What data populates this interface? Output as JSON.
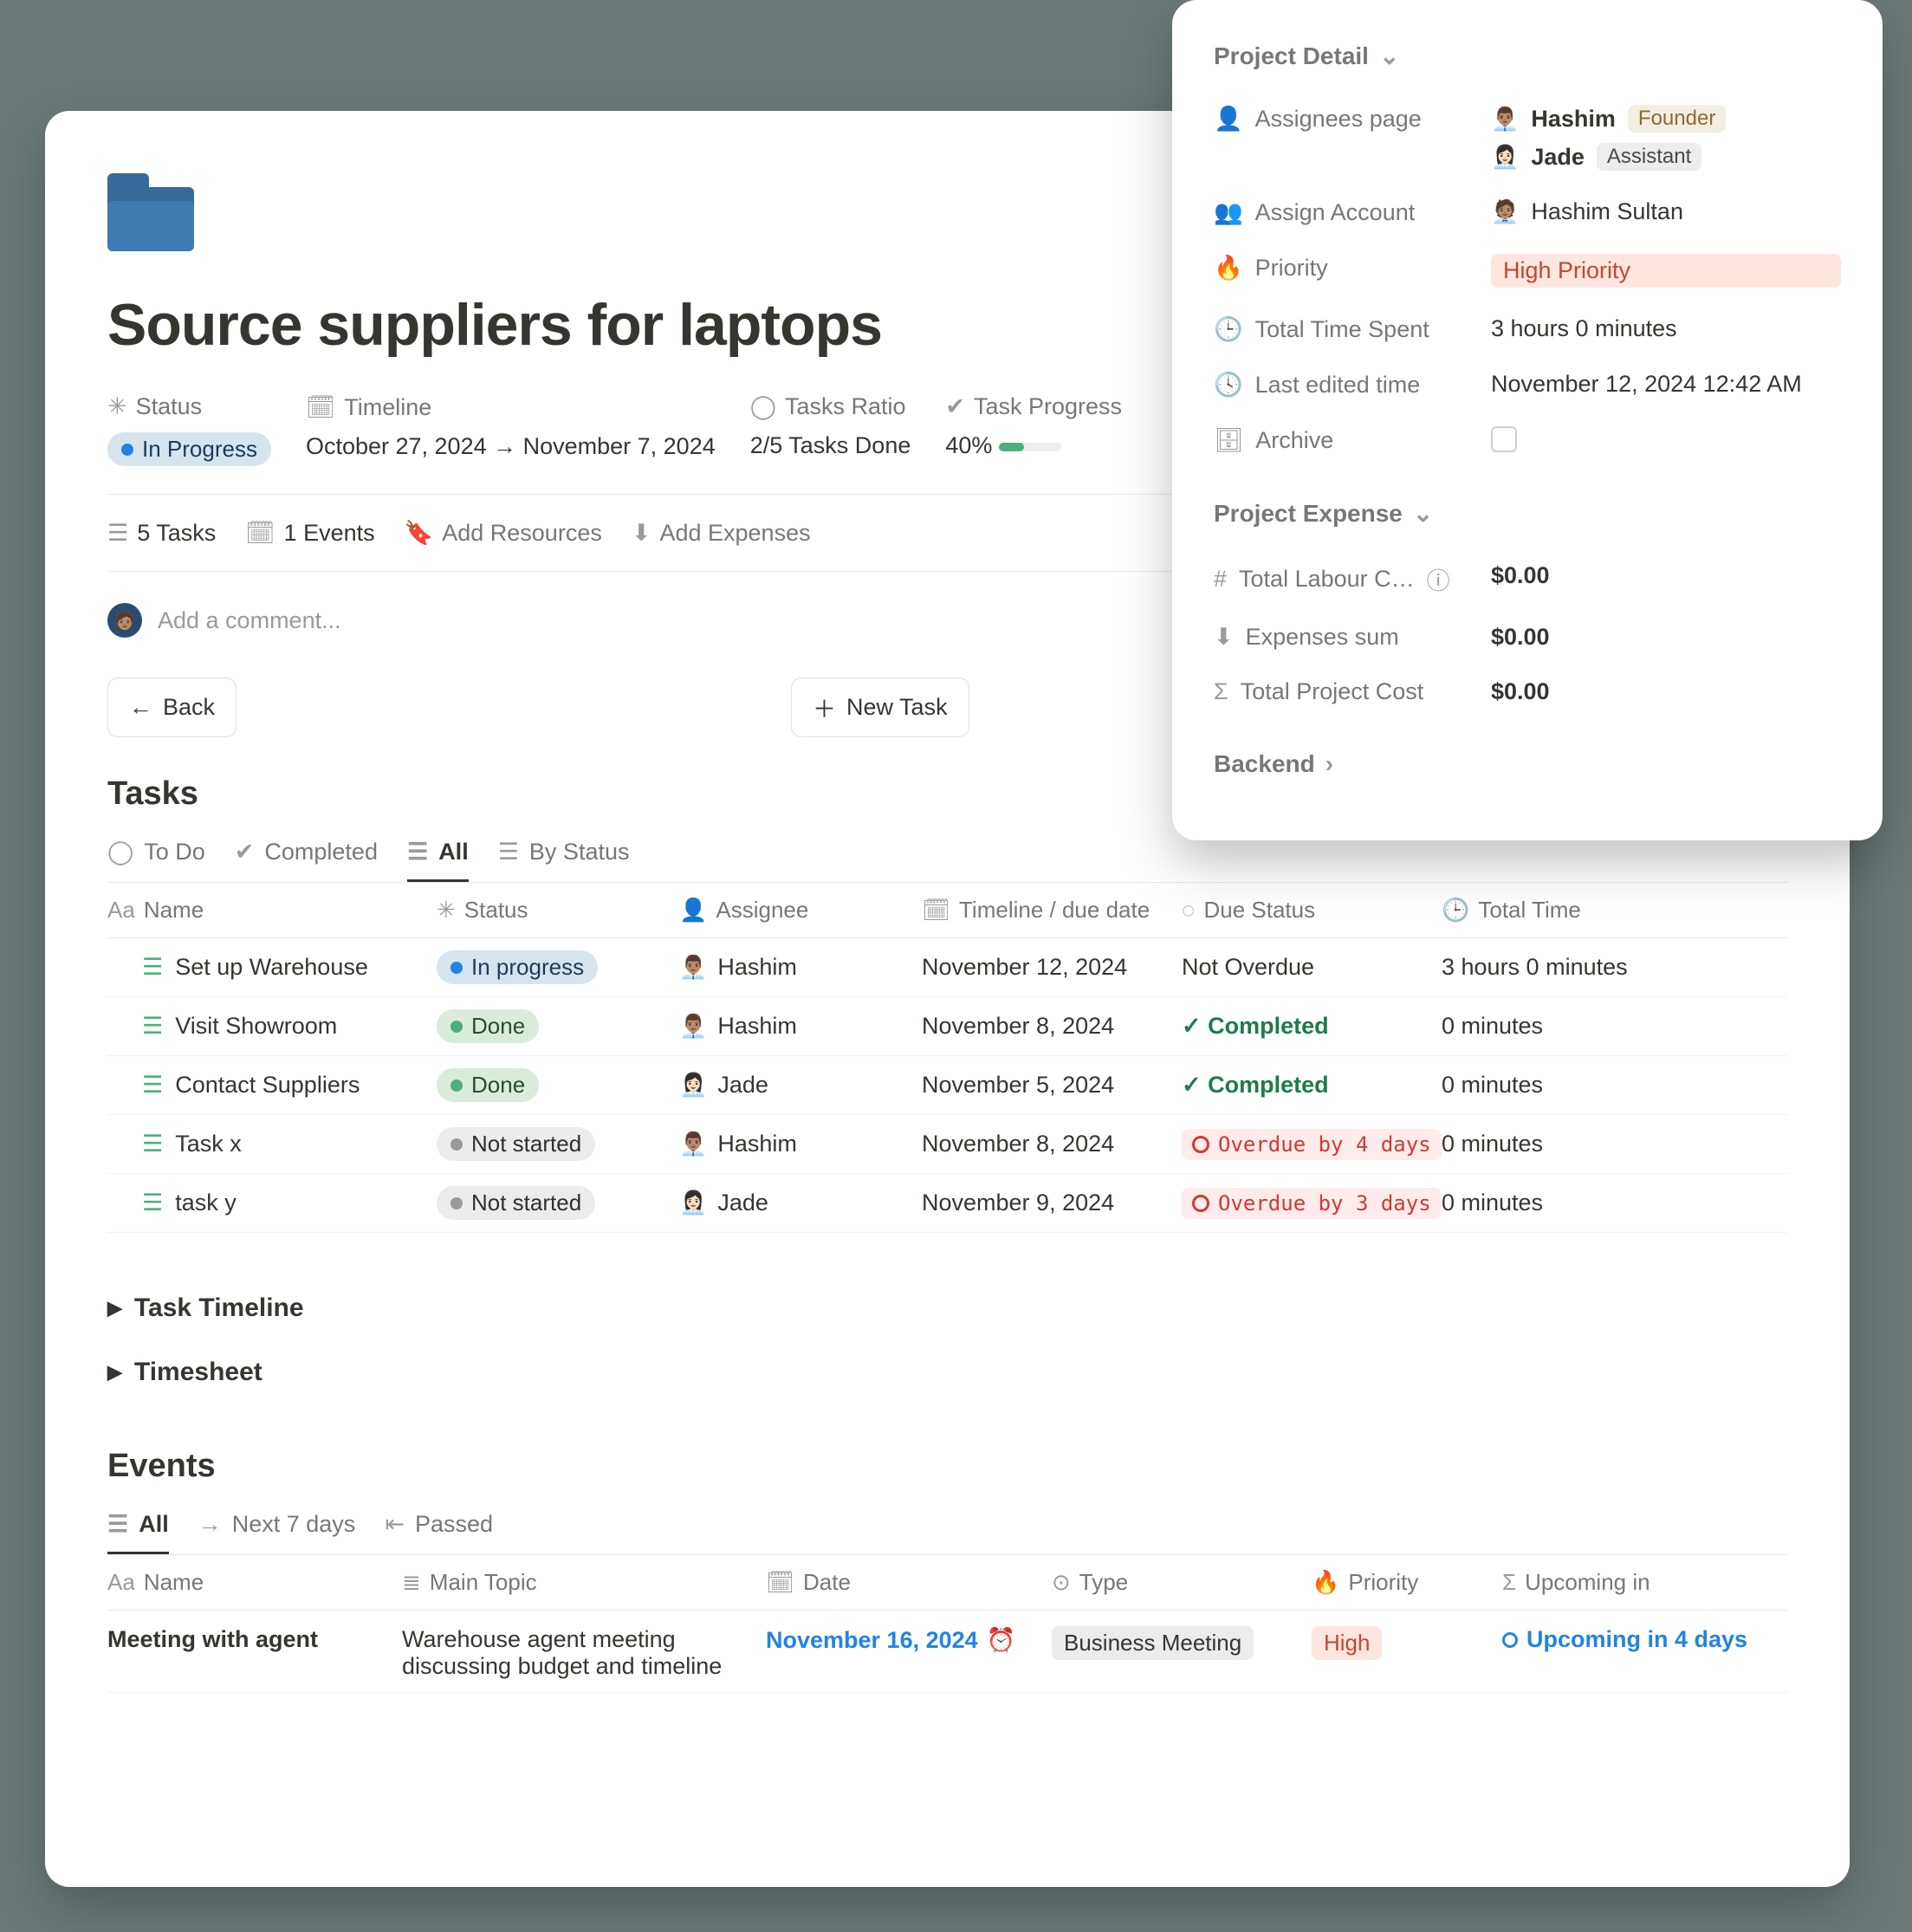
{
  "page": {
    "title": "Source suppliers for laptops"
  },
  "meta": {
    "status_label": "Status",
    "status_value": "In Progress",
    "timeline_label": "Timeline",
    "timeline_value": "October 27, 2024 → November 7, 2024",
    "ratio_label": "Tasks Ratio",
    "ratio_value": "2/5 Tasks Done",
    "progress_label": "Task Progress",
    "progress_value": "40%"
  },
  "links": {
    "tasks": "5 Tasks",
    "events": "1 Events",
    "add_resources": "Add Resources",
    "add_expenses": "Add Expenses"
  },
  "comment_placeholder": "Add a comment...",
  "buttons": {
    "back": "Back",
    "new_task": "New Task"
  },
  "tasks_section": {
    "title": "Tasks",
    "tabs": {
      "todo": "To Do",
      "completed": "Completed",
      "all": "All",
      "by_status": "By Status"
    },
    "columns": {
      "name": "Name",
      "status": "Status",
      "assignee": "Assignee",
      "timeline": "Timeline / due date",
      "due_status": "Due Status",
      "total_time": "Total Time"
    },
    "rows": [
      {
        "name": "Set up Warehouse",
        "status": "In progress",
        "status_kind": "inprogress",
        "assignee": "Hashim",
        "assignee_emoji": "👨🏽‍💼",
        "timeline": "November 12, 2024",
        "due_status": "Not Overdue",
        "due_kind": "ok",
        "total_time": "3 hours 0 minutes"
      },
      {
        "name": "Visit Showroom",
        "status": "Done",
        "status_kind": "done",
        "assignee": "Hashim",
        "assignee_emoji": "👨🏽‍💼",
        "timeline": "November 8, 2024",
        "due_status": "Completed",
        "due_kind": "completed",
        "total_time": "0 minutes"
      },
      {
        "name": "Contact Suppliers",
        "status": "Done",
        "status_kind": "done",
        "assignee": "Jade",
        "assignee_emoji": "👩🏻‍💼",
        "timeline": "November 5, 2024",
        "due_status": "Completed",
        "due_kind": "completed",
        "total_time": "0 minutes"
      },
      {
        "name": "Task x",
        "status": "Not started",
        "status_kind": "notstarted",
        "assignee": "Hashim",
        "assignee_emoji": "👨🏽‍💼",
        "timeline": "November 8, 2024",
        "due_status": "Overdue by 4 days",
        "due_kind": "overdue",
        "total_time": "0 minutes"
      },
      {
        "name": "task y",
        "status": "Not started",
        "status_kind": "notstarted",
        "assignee": "Jade",
        "assignee_emoji": "👩🏻‍💼",
        "timeline": "November 9, 2024",
        "due_status": "Overdue by 3 days",
        "due_kind": "overdue",
        "total_time": "0 minutes"
      }
    ],
    "collapsibles": {
      "task_timeline": "Task Timeline",
      "timesheet": "Timesheet"
    }
  },
  "events_section": {
    "title": "Events",
    "tabs": {
      "all": "All",
      "next7": "Next 7 days",
      "passed": "Passed"
    },
    "columns": {
      "name": "Name",
      "main_topic": "Main Topic",
      "date": "Date",
      "type": "Type",
      "priority": "Priority",
      "upcoming": "Upcoming in"
    },
    "row": {
      "name": "Meeting with agent",
      "main_topic": "Warehouse agent meeting discussing budget and timeline",
      "date": "November 16, 2024",
      "type": "Business Meeting",
      "priority": "High",
      "upcoming": "Upcoming in 4 days"
    }
  },
  "side": {
    "detail_title": "Project Detail",
    "assignees_label": "Assignees page",
    "assignees": [
      {
        "emoji": "👨🏽‍💼",
        "name": "Hashim",
        "role": "Founder",
        "role_kind": "gold"
      },
      {
        "emoji": "👩🏻‍💼",
        "name": "Jade",
        "role": "Assistant",
        "role_kind": "gray"
      }
    ],
    "account_label": "Assign Account",
    "account": {
      "emoji": "🧑🏽‍💼",
      "name": "Hashim Sultan"
    },
    "priority_label": "Priority",
    "priority_value": "High Priority",
    "time_label": "Total Time Spent",
    "time_value": "3 hours 0 minutes",
    "lastedit_label": "Last edited time",
    "lastedit_value": "November 12, 2024 12:42 AM",
    "archive_label": "Archive",
    "expense_title": "Project Expense",
    "labour_label": "Total Labour C…",
    "labour_value": "$0.00",
    "expenses_label": "Expenses sum",
    "expenses_value": "$0.00",
    "total_label": "Total Project Cost",
    "total_value": "$0.00",
    "backend": "Backend"
  }
}
